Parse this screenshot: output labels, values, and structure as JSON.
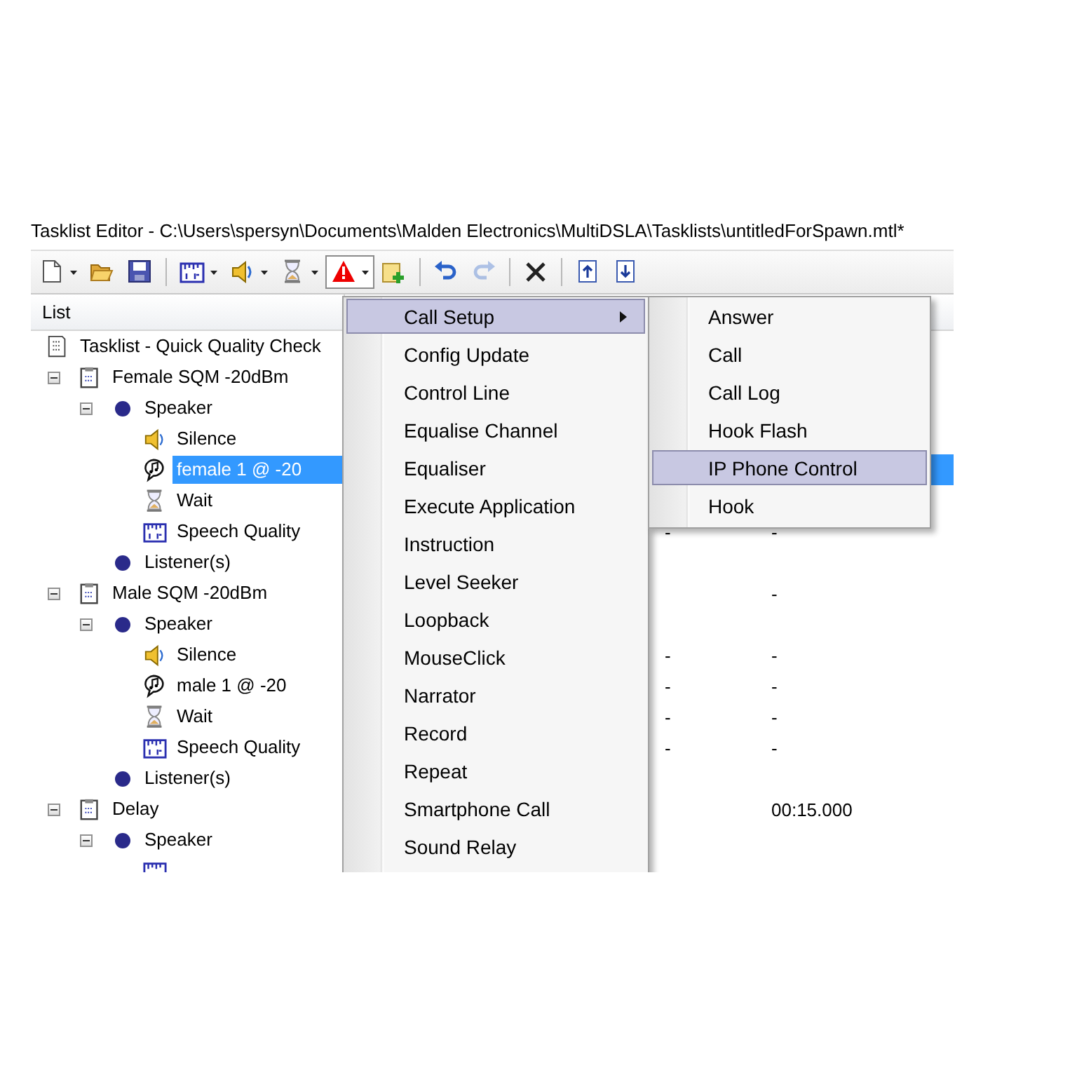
{
  "window": {
    "title": "Tasklist Editor - C:\\Users\\spersyn\\Documents\\Malden Electronics\\MultiDSLA\\Tasklists\\untitledForSpawn.mtl*"
  },
  "toolbar": [
    {
      "kind": "new",
      "dropdown": true,
      "pressed": false,
      "disabled": false
    },
    {
      "kind": "open",
      "dropdown": false,
      "pressed": false,
      "disabled": false
    },
    {
      "kind": "save",
      "dropdown": false,
      "pressed": false,
      "disabled": false
    },
    {
      "kind": "separator"
    },
    {
      "kind": "speech_quality",
      "dropdown": true,
      "pressed": false,
      "disabled": false
    },
    {
      "kind": "speaker",
      "dropdown": true,
      "pressed": false,
      "disabled": false
    },
    {
      "kind": "wait",
      "dropdown": true,
      "pressed": false,
      "disabled": false
    },
    {
      "kind": "alert",
      "dropdown": true,
      "pressed": true,
      "disabled": false
    },
    {
      "kind": "add",
      "dropdown": false,
      "pressed": false,
      "disabled": false
    },
    {
      "kind": "separator"
    },
    {
      "kind": "undo",
      "dropdown": false,
      "pressed": false,
      "disabled": false
    },
    {
      "kind": "redo",
      "dropdown": false,
      "pressed": false,
      "disabled": true
    },
    {
      "kind": "separator"
    },
    {
      "kind": "delete",
      "dropdown": false,
      "pressed": false,
      "disabled": false
    },
    {
      "kind": "separator"
    },
    {
      "kind": "move_up",
      "dropdown": false,
      "pressed": false,
      "disabled": false
    },
    {
      "kind": "move_down",
      "dropdown": false,
      "pressed": false,
      "disabled": false
    }
  ],
  "list": {
    "header": "List",
    "tree": [
      {
        "kind": "tasklist",
        "label": "Tasklist - Quick Quality Check",
        "selected": false,
        "children": [
          {
            "kind": "test",
            "label": "Female SQM -20dBm",
            "expanded": true,
            "selected": false,
            "children": [
              {
                "kind": "channel",
                "label": "Speaker",
                "expanded": true,
                "selected": false,
                "children": [
                  {
                    "kind": "silence",
                    "label": "Silence",
                    "selected": false
                  },
                  {
                    "kind": "audio",
                    "label": "female 1 @ -20",
                    "selected": true
                  },
                  {
                    "kind": "wait",
                    "label": "Wait",
                    "selected": false
                  },
                  {
                    "kind": "speech_quality",
                    "label": "Speech Quality",
                    "selected": false,
                    "column_2": "-",
                    "column_3": "-"
                  }
                ]
              },
              {
                "kind": "channel",
                "label": "Listener(s)",
                "selected": false
              }
            ]
          },
          {
            "kind": "test",
            "label": "Male SQM -20dBm",
            "expanded": true,
            "selected": false,
            "column_3": "-",
            "children": [
              {
                "kind": "channel",
                "label": "Speaker",
                "expanded": true,
                "selected": false,
                "children": [
                  {
                    "kind": "silence",
                    "label": "Silence",
                    "selected": false,
                    "column_2": "-",
                    "column_3": "-"
                  },
                  {
                    "kind": "audio",
                    "label": "male 1 @ -20",
                    "selected": false,
                    "column_2": "-",
                    "column_3": "-"
                  },
                  {
                    "kind": "wait",
                    "label": "Wait",
                    "selected": false,
                    "column_2": "-",
                    "column_3": "-"
                  },
                  {
                    "kind": "speech_quality",
                    "label": "Speech Quality",
                    "selected": false,
                    "column_2": "-",
                    "column_3": "-"
                  }
                ]
              },
              {
                "kind": "channel",
                "label": "Listener(s)",
                "selected": false
              }
            ]
          },
          {
            "kind": "test",
            "label": "Delay",
            "expanded": true,
            "selected": false,
            "column_3": "00:15.000",
            "children": [
              {
                "kind": "channel",
                "label": "Speaker",
                "expanded": true,
                "selected": false,
                "children": [
                  {
                    "kind": "speech_quality"
                  }
                ]
              }
            ]
          }
        ]
      }
    ]
  },
  "menu": {
    "items": [
      {
        "label": "Call Setup",
        "selected": true,
        "submenu": true
      },
      {
        "label": "Config Update",
        "selected": false,
        "submenu": false
      },
      {
        "label": "Control Line",
        "selected": false,
        "submenu": false
      },
      {
        "label": "Equalise Channel",
        "selected": false,
        "submenu": false
      },
      {
        "label": "Equaliser",
        "selected": false,
        "submenu": false
      },
      {
        "label": "Execute Application",
        "selected": false,
        "submenu": false
      },
      {
        "label": "Instruction",
        "selected": false,
        "submenu": false
      },
      {
        "label": "Level Seeker",
        "selected": false,
        "submenu": false
      },
      {
        "label": "Loopback",
        "selected": false,
        "submenu": false
      },
      {
        "label": "MouseClick",
        "selected": false,
        "submenu": false
      },
      {
        "label": "Narrator",
        "selected": false,
        "submenu": false
      },
      {
        "label": "Record",
        "selected": false,
        "submenu": false
      },
      {
        "label": "Repeat",
        "selected": false,
        "submenu": false
      },
      {
        "label": "Smartphone Call",
        "selected": false,
        "submenu": false
      },
      {
        "label": "Sound Relay",
        "selected": false,
        "submenu": false
      }
    ]
  },
  "submenu": {
    "items": [
      {
        "label": "Answer",
        "selected": false
      },
      {
        "label": "Call",
        "selected": false
      },
      {
        "label": "Call Log",
        "selected": false
      },
      {
        "label": "Hook Flash",
        "selected": false
      },
      {
        "label": "IP Phone Control",
        "selected": true
      },
      {
        "label": "Hook",
        "selected": false
      }
    ]
  }
}
